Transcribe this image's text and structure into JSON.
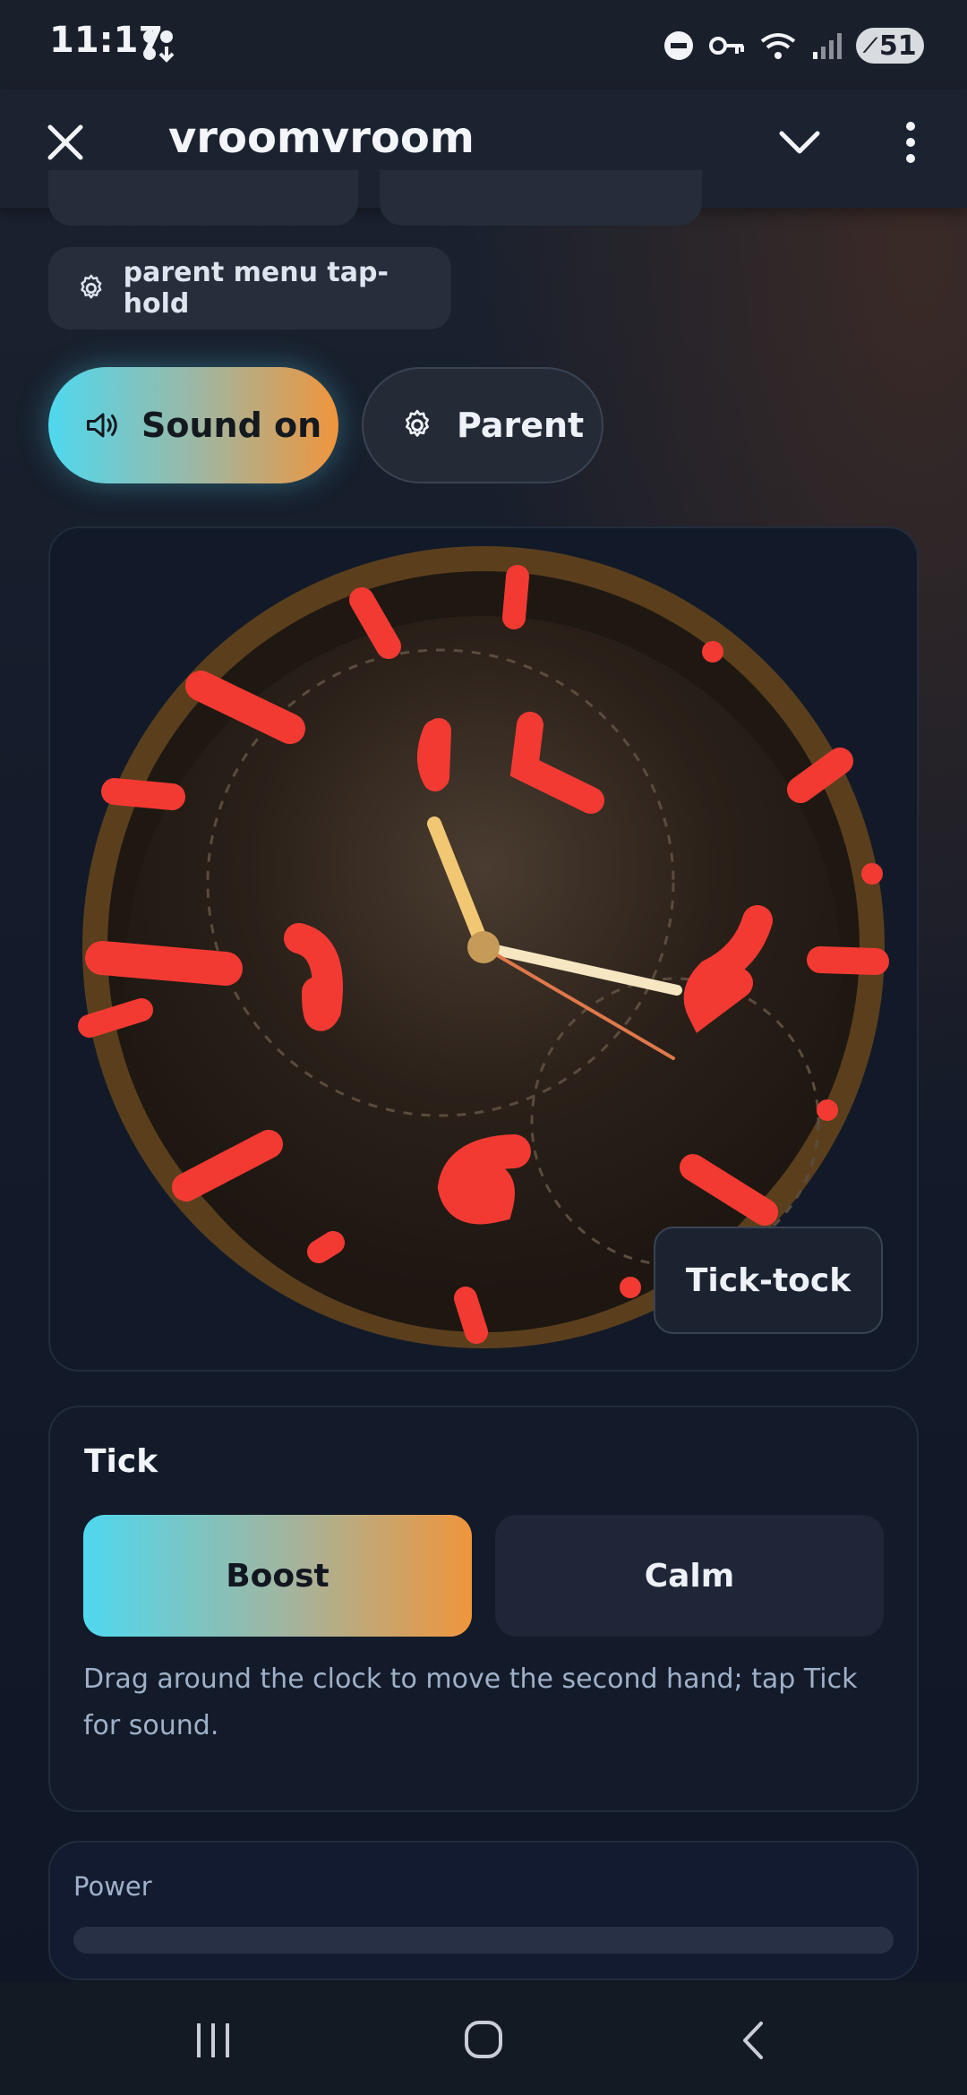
{
  "status_bar": {
    "time": "11:17",
    "battery": "51",
    "icons": [
      "notification-dots-icon",
      "do-not-disturb-icon",
      "vpn-key-icon",
      "wifi-icon",
      "signal-icon",
      "battery-saver-icon"
    ]
  },
  "app_bar": {
    "title": "vroomvroom",
    "icons": [
      "close-icon",
      "chevron-down-icon",
      "more-vert-icon"
    ]
  },
  "chip": {
    "label": "parent menu tap-hold"
  },
  "pills": {
    "sound": "Sound on",
    "parent": "Parent"
  },
  "clock": {
    "badge": "Tick-tock",
    "colors": {
      "rim": "#5b3f1d",
      "face": "#2b2119",
      "hour_hand": "#f1c774",
      "minute_hand": "#f6e6c2",
      "second_hand": "#e0784a",
      "scribble": "#f23a33"
    }
  },
  "tick_card": {
    "title": "Tick",
    "boost": "Boost",
    "calm": "Calm",
    "hint": "Drag around the clock to move the second hand; tap Tick for sound."
  },
  "power": {
    "label": "Power"
  },
  "accent": {
    "cyan": "#4fd8ef",
    "orange": "#f0953c"
  }
}
